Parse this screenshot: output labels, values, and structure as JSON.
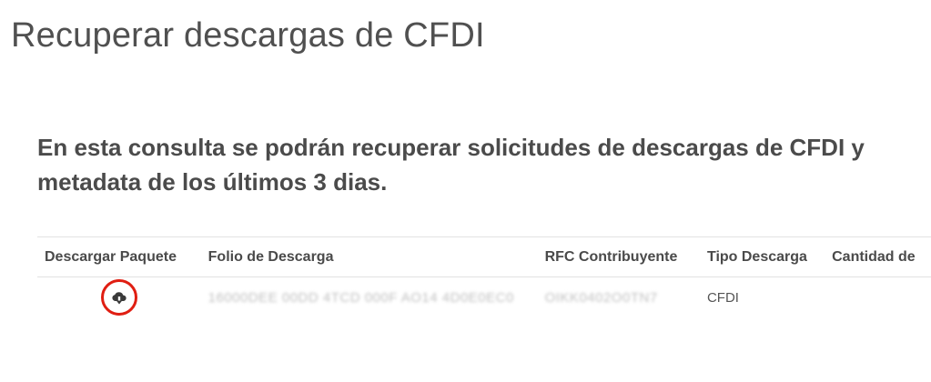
{
  "page": {
    "title": "Recuperar descargas de CFDI",
    "intro": "En esta consulta se podrán recuperar solicitudes de descargas de CFDI y metadata de los últimos 3 dias."
  },
  "table": {
    "headers": {
      "paquete": "Descargar Paquete",
      "folio": "Folio de Descarga",
      "rfc": "RFC Contribuyente",
      "tipo": "Tipo Descarga",
      "cantidad": "Cantidad de"
    },
    "rows": [
      {
        "folio": "16000DEE 00DD 4TCD 000F AO14 4D0E0EC0",
        "rfc": "OIKK0402O0TN7",
        "tipo": "CFDI",
        "cantidad": ""
      }
    ]
  },
  "icons": {
    "download": "cloud-download-icon"
  },
  "colors": {
    "highlight_ring": "#e01e12",
    "text": "#4a4a4a"
  }
}
